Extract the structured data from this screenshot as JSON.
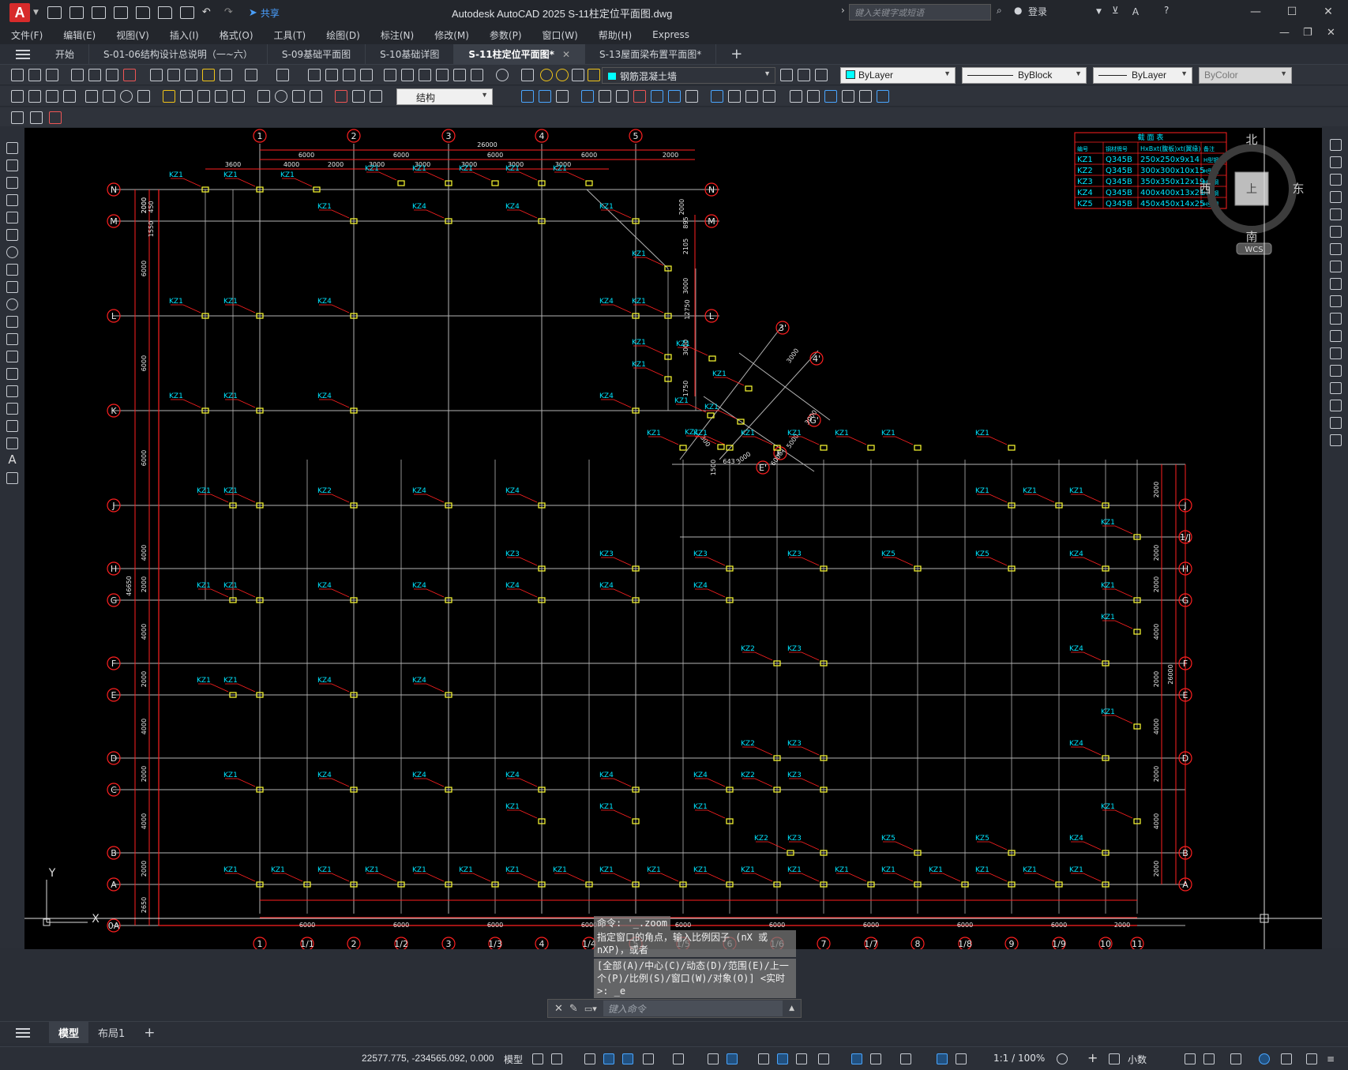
{
  "app": {
    "logo": "A",
    "title": "Autodesk AutoCAD 2025    S-11柱定位平面图.dwg",
    "share": "共享",
    "search_placeholder": "键入关键字或短语",
    "login": "登录"
  },
  "menu": [
    "文件(F)",
    "编辑(E)",
    "视图(V)",
    "插入(I)",
    "格式(O)",
    "工具(T)",
    "绘图(D)",
    "标注(N)",
    "修改(M)",
    "参数(P)",
    "窗口(W)",
    "帮助(H)",
    "Express"
  ],
  "tabs": [
    {
      "label": "开始",
      "active": false
    },
    {
      "label": "S-01-06结构设计总说明（一~六）",
      "active": false
    },
    {
      "label": "S-09基础平面图",
      "active": false
    },
    {
      "label": "S-10基础详图",
      "active": false
    },
    {
      "label": "S-11柱定位平面图*",
      "active": true
    },
    {
      "label": "S-13屋面梁布置平面图*",
      "active": false
    }
  ],
  "toolbar": {
    "layer": "钢筋混凝土墙",
    "color": "ByLayer",
    "linetype": "ByBlock",
    "lineweight": "ByLayer",
    "plotstyle": "ByColor",
    "style": "结构"
  },
  "viewcube": {
    "north": "北",
    "south": "南",
    "east": "东",
    "west": "西",
    "top": "上",
    "wcs": "WCS"
  },
  "section_table": {
    "title": "截    面    表",
    "headers": [
      "编号",
      "钢材牌号",
      "HxBxt(腹板)xt(翼缘)",
      "备注"
    ],
    "rows": [
      [
        "KZ1",
        "Q345B",
        "250x250x9x14",
        "H型钢"
      ],
      [
        "KZ2",
        "Q345B",
        "300x300x10x15",
        "H型钢"
      ],
      [
        "KZ3",
        "Q345B",
        "350x350x12x19",
        "H型钢"
      ],
      [
        "KZ4",
        "Q345B",
        "400x400x13x21",
        "H型钢"
      ],
      [
        "KZ5",
        "Q345B",
        "450x450x14x25",
        "H型钢"
      ]
    ]
  },
  "drawing": {
    "top_axes": [
      "1",
      "2",
      "3",
      "4",
      "5"
    ],
    "bottom_axes": [
      "1",
      "1/1",
      "2",
      "1/2",
      "3",
      "1/3",
      "4",
      "1/4",
      "5",
      "1/5",
      "6",
      "1/6",
      "7",
      "1/7",
      "8",
      "1/8",
      "9",
      "1/9",
      "10",
      "11"
    ],
    "left_axes": [
      "N",
      "M",
      "L",
      "K",
      "J",
      "H",
      "G",
      "F",
      "E",
      "D",
      "C",
      "B",
      "A",
      "0A"
    ],
    "right_axes": [
      "N",
      "M",
      "L",
      "J",
      "1/J",
      "H",
      "G",
      "F",
      "E",
      "D",
      "B",
      "A"
    ],
    "diag_axes": [
      "3'",
      "4'",
      "G'",
      "F'",
      "E'"
    ],
    "top_dims": [
      "6000",
      "6000",
      "6000",
      "6000",
      "2000"
    ],
    "top_total": "26000",
    "top_sub_dims": [
      "3600",
      "4000",
      "2000",
      "3000",
      "3000",
      "3000",
      "3000",
      "3000"
    ],
    "left_dims": [
      "2000",
      "6000",
      "6000",
      "6000",
      "4000",
      "2000",
      "4000",
      "2000",
      "4000",
      "2000",
      "4000",
      "2000",
      "2650"
    ],
    "left_total": "46650",
    "bottom_dims": [
      "6000",
      "6000",
      "6000",
      "6000",
      "6000",
      "6000",
      "6000",
      "6000",
      "6000",
      "2000"
    ],
    "right_dims": [
      "2000",
      "2000",
      "2000",
      "4000",
      "2000",
      "4000",
      "2000",
      "4000",
      "2000"
    ],
    "right_total": "26000",
    "diag_dims": [
      "3000",
      "3000",
      "5000",
      "6000",
      "300",
      "3000",
      "643",
      "1500",
      "1750",
      "3000",
      "3000",
      "2105",
      "895",
      "2000",
      "12750",
      "1550",
      "450",
      "2000"
    ]
  },
  "command": {
    "history": [
      "命令: '_.zoom",
      "指定窗口的角点，输入比例因子 (nX 或 nXP)，或者",
      "[全部(A)/中心(C)/动态(D)/范围(E)/上一个(P)/比例(S)/窗口(W)/对象(O)] <实时>: _e"
    ],
    "placeholder": "键入命令"
  },
  "layout_tabs": [
    "模型",
    "布局1"
  ],
  "status": {
    "coords": "22577.775, -234565.092, 0.000",
    "model": "模型",
    "scale": "1:1 / 100%",
    "units": "小数"
  },
  "ucs": {
    "y": "Y",
    "x": "X"
  }
}
